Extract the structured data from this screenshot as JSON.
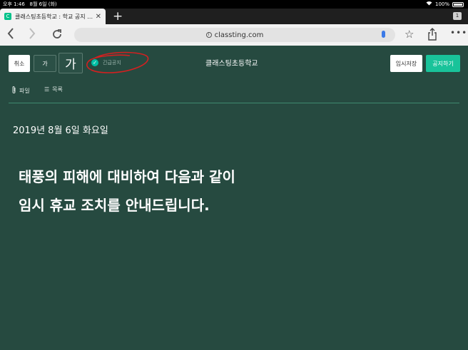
{
  "status_bar": {
    "time": "오후 1:46",
    "date": "8월 6일 (화)",
    "battery": "100%"
  },
  "browser": {
    "tab_title": "클래스팅초등학교 : 학교 공지 …",
    "favicon_letter": "C",
    "tab_count": "1",
    "url": "classting.com"
  },
  "toolbar": {
    "cancel_label": "취소",
    "font_small_label": "가",
    "font_large_label": "가",
    "urgent_label": "긴급공지",
    "school_name": "클래스팅초등학교",
    "save_draft_label": "임시저장",
    "publish_label": "공지하기",
    "file_label": "파일",
    "list_label": "목록"
  },
  "content": {
    "date_line": "2019년 8월 6일 화요일",
    "line1": "태풍의 피해에 대비하여 다음과 같이",
    "line2": "임시 휴교 조치를 안내드립니다."
  },
  "colors": {
    "background": "#264a40",
    "accent": "#19c39a",
    "annotation": "#d42020"
  }
}
